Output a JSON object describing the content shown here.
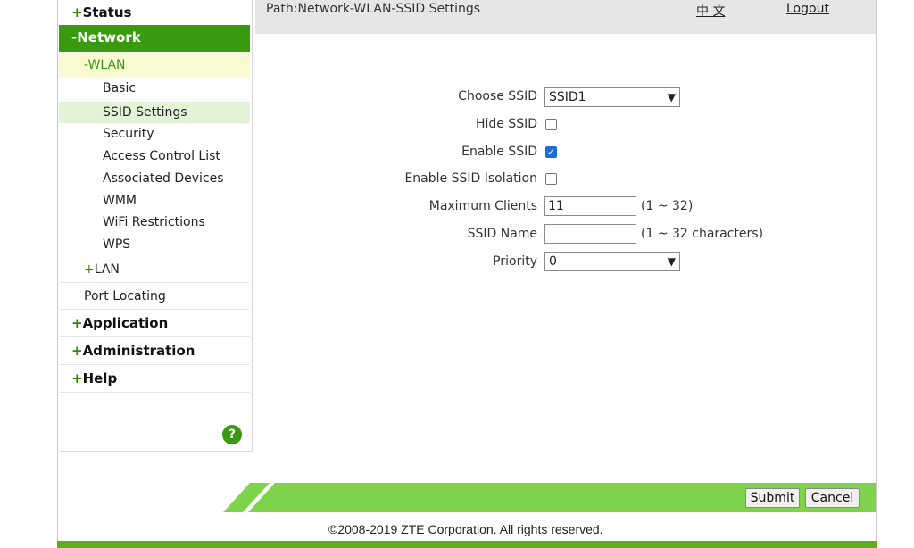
{
  "sidebar": {
    "status": {
      "sign": "+",
      "label": "Status"
    },
    "network": {
      "sign": "-",
      "label": "Network"
    },
    "wlan": {
      "sign": "-",
      "label": "WLAN"
    },
    "wlan_items": [
      "Basic",
      "SSID Settings",
      "Security",
      "Access Control List",
      "Associated Devices",
      "WMM",
      "WiFi Restrictions",
      "WPS"
    ],
    "lan": {
      "sign": "+",
      "label": "LAN"
    },
    "port_locating": "Port Locating",
    "application": {
      "sign": "+",
      "label": "Application"
    },
    "administration": {
      "sign": "+",
      "label": "Administration"
    },
    "help": {
      "sign": "+",
      "label": "Help"
    },
    "help_icon_text": "?"
  },
  "header": {
    "path": "Path:Network-WLAN-SSID Settings",
    "language": "中 文",
    "logout": "Logout"
  },
  "form": {
    "choose_ssid_label": "Choose SSID",
    "choose_ssid_value": "SSID1",
    "hide_ssid_label": "Hide SSID",
    "hide_ssid_checked": false,
    "enable_ssid_label": "Enable SSID",
    "enable_ssid_checked": true,
    "enable_isolation_label": "Enable SSID Isolation",
    "enable_isolation_checked": false,
    "max_clients_label": "Maximum Clients",
    "max_clients_value": "11",
    "max_clients_hint": "(1 ~ 32)",
    "ssid_name_label": "SSID Name",
    "ssid_name_value": "",
    "ssid_name_hint": "(1 ~ 32 characters)",
    "priority_label": "Priority",
    "priority_value": "0"
  },
  "footer": {
    "submit": "Submit",
    "cancel": "Cancel",
    "copyright": "©2008-2019 ZTE Corporation. All rights reserved."
  },
  "colors": {
    "brand_green": "#3a9a0f",
    "footer_green": "#7ed34a",
    "checkbox_blue": "#1f6fd1"
  }
}
